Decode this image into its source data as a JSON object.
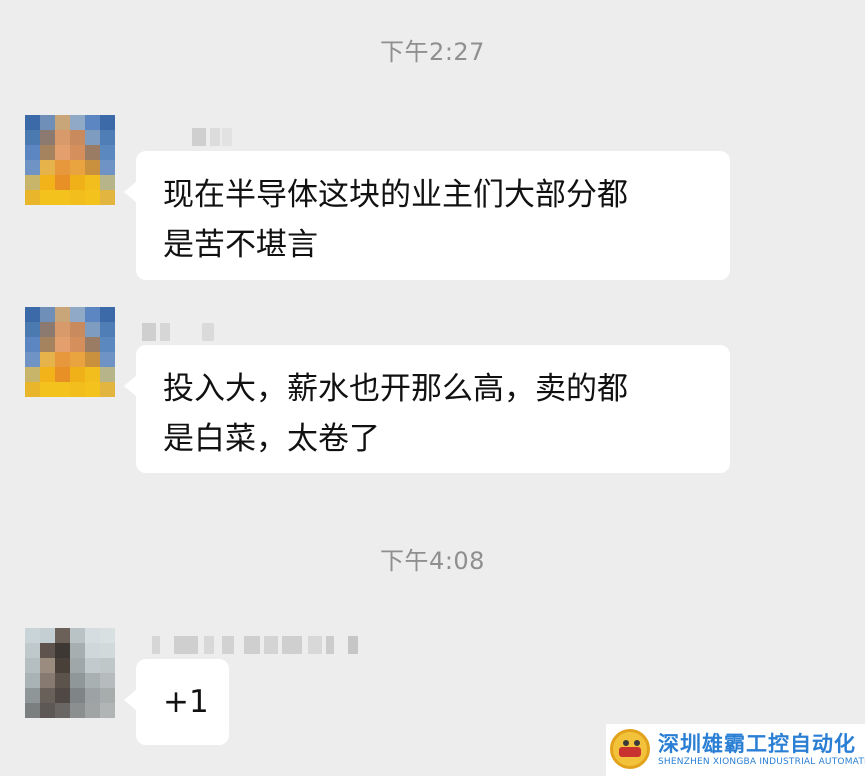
{
  "chat": {
    "timestamps": [
      "下午2:27",
      "下午4:08"
    ],
    "messages": [
      {
        "lines": [
          "现在半导体这块的业主们大部分都",
          "是苦不堪言"
        ]
      },
      {
        "lines": [
          "投入大，薪水也开那么高，卖的都",
          "是白菜，太卷了"
        ]
      },
      {
        "lines": [
          "+1"
        ]
      }
    ]
  },
  "watermark": {
    "name_cn": "深圳雄霸工控自动化",
    "name_en": "SHENZHEN XIONGBA INDUSTRIAL AUTOMATION"
  },
  "colors": {
    "background": "#ededed",
    "bubble": "#ffffff",
    "timestamp": "#8f8f8f",
    "logo_text": "#2a7fd4"
  }
}
